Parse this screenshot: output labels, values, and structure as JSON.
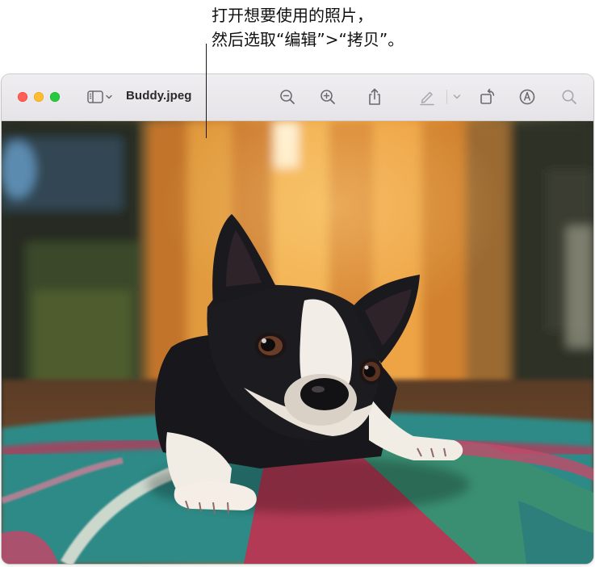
{
  "callout": {
    "line1": "打开想要使用的照片，",
    "line2": "然后选取“编辑”>“拷贝”。"
  },
  "window": {
    "filename": "Buddy.jpeg",
    "traffic_lights": {
      "close": "#ff5f57",
      "minimize": "#febc2e",
      "zoom": "#28c840"
    },
    "toolbar": {
      "icons": [
        "sidebar-icon",
        "chevron-down-icon",
        "zoom-out-icon",
        "zoom-in-icon",
        "share-icon",
        "markup-pen-icon",
        "chevron-down-icon",
        "rotate-icon",
        "annotate-icon",
        "search-icon"
      ]
    }
  },
  "photo": {
    "subject": "dog-photo",
    "colors": {
      "curtain": "#e08a2a",
      "rug_teal": "#2f8a86",
      "rug_red": "#b43a5a",
      "dog": "#18171c"
    }
  }
}
